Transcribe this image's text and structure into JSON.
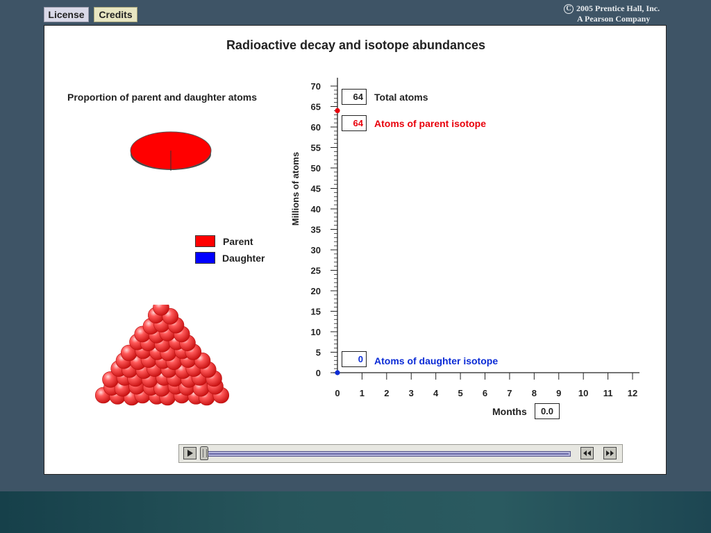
{
  "top_buttons": {
    "license": "License",
    "credits": "Credits"
  },
  "copyright": {
    "symbol": "C",
    "line1": "2005 Prentice Hall, Inc.",
    "line2": "A Pearson Company"
  },
  "main_title": "Radioactive decay and isotope abundances",
  "pie": {
    "title": "Proportion of parent and daughter atoms",
    "parent_fraction": 1.0,
    "daughter_fraction": 0.0
  },
  "legend": [
    {
      "label": "Parent",
      "color": "#ff0000"
    },
    {
      "label": "Daughter",
      "color": "#0000ff"
    }
  ],
  "atoms_pile": {
    "icon": "red-sphere-pile",
    "color": "#ff3b3b"
  },
  "readouts": {
    "total_atoms": {
      "value": "64",
      "label": "Total atoms",
      "color": "#222222"
    },
    "parent_atoms": {
      "value": "64",
      "label": "Atoms of parent isotope",
      "color": "#e8000b"
    },
    "daughter_atoms": {
      "value": "0",
      "label": "Atoms of daughter isotope",
      "color": "#0a2bd6"
    }
  },
  "months_readout": {
    "label": "Months",
    "value": "0.0"
  },
  "controls": {
    "play_icon": "play-icon",
    "rewind_icon": "rewind-icon",
    "fast_forward_icon": "fast-forward-icon",
    "position": 0.0
  },
  "chart_data": {
    "type": "line",
    "title": "",
    "xlabel": "",
    "ylabel": "Millions of atoms",
    "xlim": [
      0,
      12
    ],
    "ylim": [
      0,
      70
    ],
    "x_ticks": [
      "0",
      "1",
      "2",
      "3",
      "4",
      "5",
      "6",
      "7",
      "8",
      "9",
      "10",
      "11",
      "12"
    ],
    "y_ticks": [
      "0",
      "5",
      "10",
      "15",
      "20",
      "25",
      "30",
      "35",
      "40",
      "45",
      "50",
      "55",
      "60",
      "65",
      "70"
    ],
    "grid": false,
    "series": [
      {
        "name": "Atoms of parent isotope",
        "color": "#e8000b",
        "points": [
          [
            0,
            64
          ]
        ]
      },
      {
        "name": "Atoms of daughter isotope",
        "color": "#0a2bd6",
        "points": [
          [
            0,
            0
          ]
        ]
      }
    ]
  }
}
